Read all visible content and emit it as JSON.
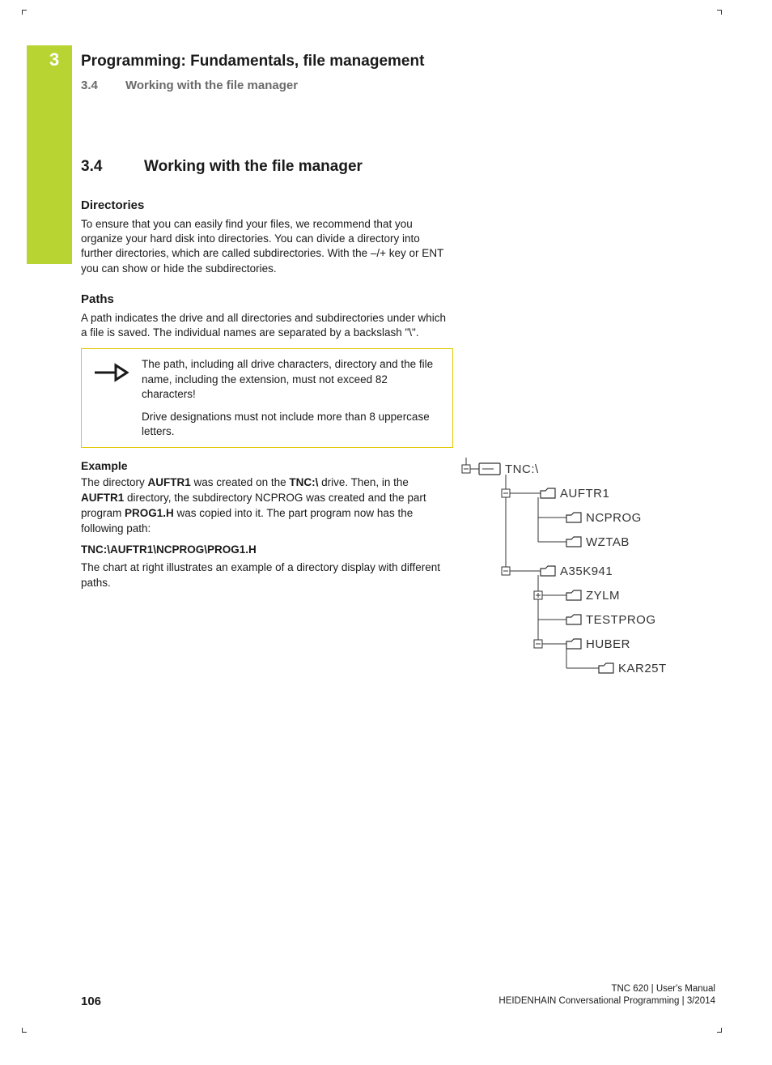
{
  "chapter_number": "3",
  "chapter_title": "Programming: Fundamentals, file management",
  "section_number": "3.4",
  "section_title": "Working with the file manager",
  "body_heading_number": "3.4",
  "body_heading_title": "Working with the file manager",
  "directories": {
    "heading": "Directories",
    "para": "To ensure that you can easily find your files, we recommend that you organize your hard disk into directories. You can divide a directory into further directories, which are called subdirectories. With the –/+ key or ENT you can show or hide the subdirectories."
  },
  "paths": {
    "heading": "Paths",
    "para": "A path indicates the drive and all directories and subdirectories under which a file is saved. The individual names are separated by a backslash \"\\\"."
  },
  "note": {
    "p1": "The path, including all drive characters, directory and the file name, including the extension, must not exceed 82 characters!",
    "p2": "Drive designations must not include more than 8 uppercase letters."
  },
  "example": {
    "heading": "Example",
    "para_parts": {
      "t1": "The directory ",
      "b1": "AUFTR1",
      "t2": " was created on the ",
      "b2": "TNC:\\",
      "t3": " drive. Then, in the ",
      "b3": "AUFTR1",
      "t4": " directory, the subdirectory NCPROG was created and the part program ",
      "b4": "PROG1.H",
      "t5": " was copied into it. The part program now has the following path:"
    },
    "path": "TNC:\\AUFTR1\\NCPROG\\PROG1.H",
    "tail": "The chart at right illustrates an example of a directory display with different paths."
  },
  "tree": {
    "root": "TNC:\\",
    "nodes": [
      {
        "label": "AUFTR1",
        "level": 1
      },
      {
        "label": "NCPROG",
        "level": 2
      },
      {
        "label": "WZTAB",
        "level": 2
      },
      {
        "label": "A35K941",
        "level": 1
      },
      {
        "label": "ZYLM",
        "level": 2
      },
      {
        "label": "TESTPROG",
        "level": 2
      },
      {
        "label": "HUBER",
        "level": 2
      },
      {
        "label": "KAR25T",
        "level": 3
      }
    ]
  },
  "footer": {
    "page": "106",
    "line1": "TNC 620 | User's Manual",
    "line2": "HEIDENHAIN Conversational Programming | 3/2014"
  }
}
